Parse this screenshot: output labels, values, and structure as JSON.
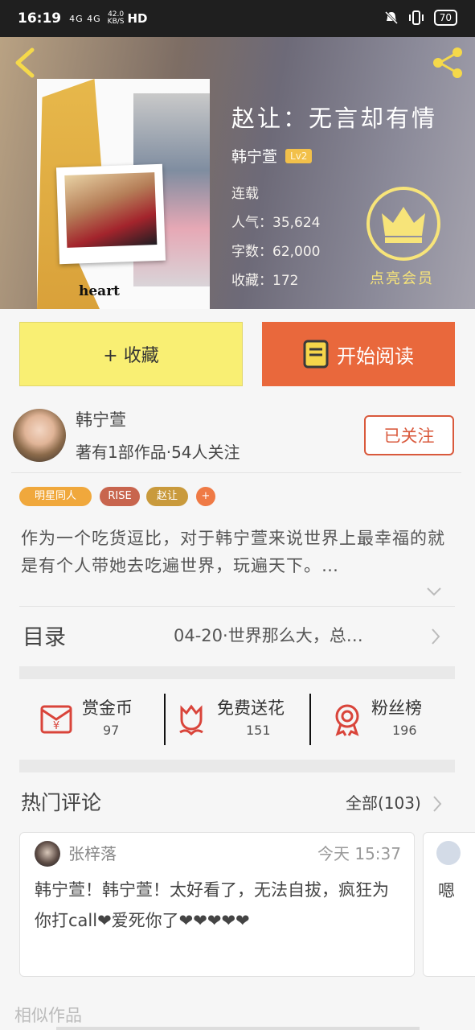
{
  "status_bar": {
    "time": "16:19",
    "signal": "4G 4G",
    "net_speed": "42.0",
    "net_unit": "KB/S",
    "hd": "HD",
    "battery": "70"
  },
  "book": {
    "title": "赵让：无言却有情",
    "author": "韩宁萱",
    "level": "Lv2",
    "status": "连载",
    "popularity": "人气：35,624",
    "word_count": "字数：62,000",
    "favorites": "收藏：172",
    "vip_label": "点亮会员",
    "cover_caption": "heart"
  },
  "actions": {
    "favorite": "+ 收藏",
    "read": "开始阅读"
  },
  "author_card": {
    "name": "韩宁萱",
    "info": "著有1部作品·54人关注",
    "follow_label": "已关注"
  },
  "tags": [
    "明星同人",
    "RISE",
    "赵让",
    "+"
  ],
  "description": "作为一个吃货逗比，对于韩宁萱来说世界上最幸福的就是有个人带她去吃遍世界，玩遍天下。…",
  "toc": {
    "label": "目录",
    "latest": "04-20·世界那么大，总…"
  },
  "stats": [
    {
      "label": "赏金币",
      "value": "97",
      "icon": "red-envelope-icon"
    },
    {
      "label": "免费送花",
      "value": "151",
      "icon": "flower-icon"
    },
    {
      "label": "粉丝榜",
      "value": "196",
      "icon": "medal-icon"
    }
  ],
  "comments": {
    "title": "热门评论",
    "all_label": "全部(103)",
    "items": [
      {
        "user": "张梓落",
        "time": "今天 15:37",
        "text": "韩宁萱！韩宁萱！太好看了，无法自拔，疯狂为你打call❤爱死你了❤❤❤❤❤"
      },
      {
        "user": "",
        "time": "",
        "text": "嗯"
      }
    ]
  },
  "similar_label": "相似作品",
  "colors": {
    "accent_orange": "#e9683c",
    "fav_yellow": "#f9ef73",
    "vip_gold": "#f7e479"
  }
}
